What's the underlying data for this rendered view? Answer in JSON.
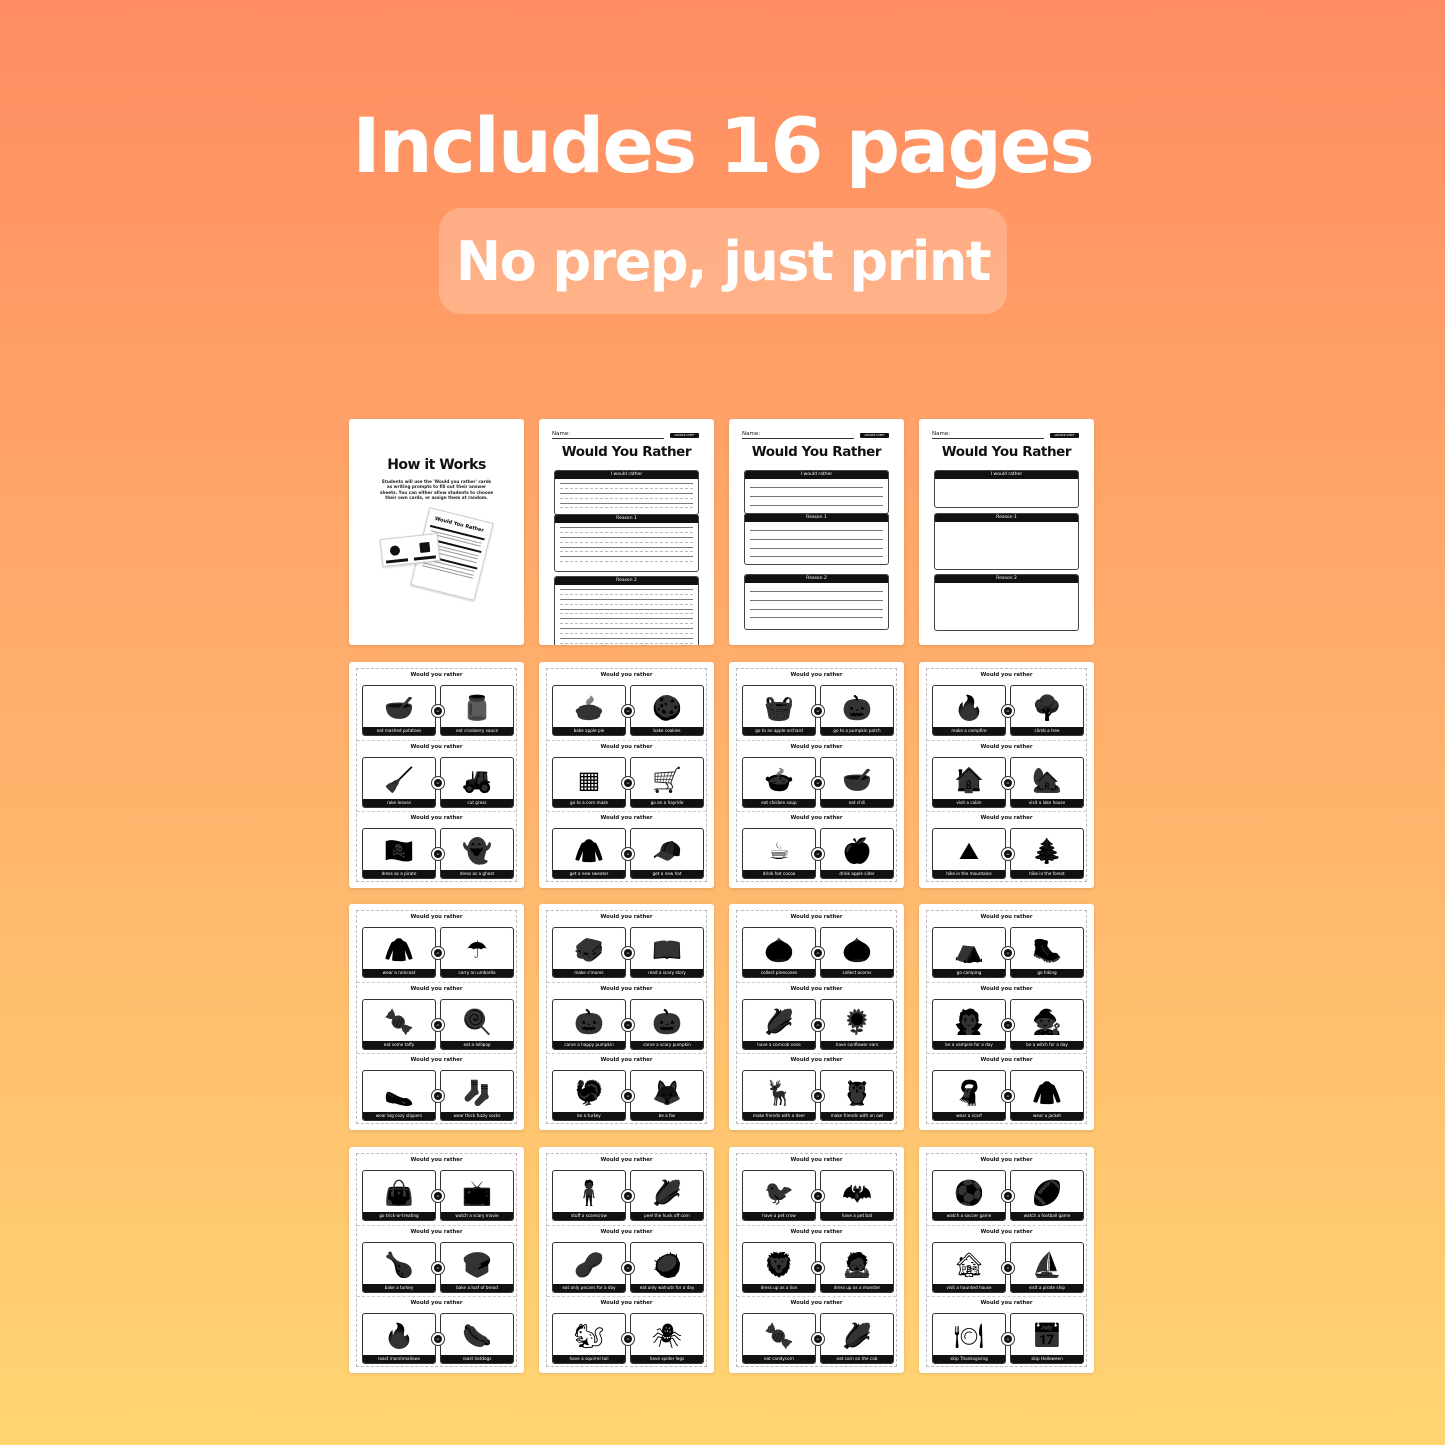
{
  "header": {
    "title": "Includes 16 pages",
    "subtitle": "No prep, just print"
  },
  "colors": {
    "gradient_top": "#ff8c62",
    "gradient_bottom": "#ffd572",
    "text": "#ffffff",
    "ink": "#111111"
  },
  "how_it_works": {
    "title": "How it Works",
    "body": "Students will use the 'Would you rather' cards as writing prompts to fill out their answer sheets. You can either allow students to choose their own cards, or assign them at random.",
    "illustration_title": "Would You Rather"
  },
  "answer_sheets": [
    {
      "name_label": "Name:",
      "badge": "ANSWER SHEET",
      "title": "Would You Rather",
      "sections": [
        "I would rather",
        "Reason 1",
        "Reason 2"
      ],
      "style": "dashed-lines"
    },
    {
      "name_label": "Name:",
      "badge": "ANSWER SHEET",
      "title": "Would You Rather",
      "sections": [
        "I would rather",
        "Reason 1",
        "Reason 2"
      ],
      "style": "lines"
    },
    {
      "name_label": "Name:",
      "badge": "ANSWER SHEET",
      "title": "Would You Rather",
      "sections": [
        "I would rather",
        "Reason 1",
        "Reason 2"
      ],
      "style": "blank"
    }
  ],
  "question_label": "Would you rather",
  "or_label": "or",
  "card_pages": [
    [
      [
        {
          "label": "eat mashed potatoes",
          "icon": "mashed-potatoes-icon",
          "glyph": "🥣"
        },
        {
          "label": "eat cranberry sauce",
          "icon": "jar-icon",
          "glyph": "🫙"
        }
      ],
      [
        {
          "label": "rake leaves",
          "icon": "rake-icon",
          "glyph": "🧹"
        },
        {
          "label": "cut grass",
          "icon": "lawnmower-icon",
          "glyph": "🚜"
        }
      ],
      [
        {
          "label": "dress as a pirate",
          "icon": "pirate-icon",
          "glyph": "🏴‍☠️"
        },
        {
          "label": "dress as a ghost",
          "icon": "ghost-icon",
          "glyph": "👻"
        }
      ]
    ],
    [
      [
        {
          "label": "bake apple pie",
          "icon": "pie-icon",
          "glyph": "🥧"
        },
        {
          "label": "bake cookies",
          "icon": "cookie-icon",
          "glyph": "🍪"
        }
      ],
      [
        {
          "label": "go to a corn maze",
          "icon": "maze-icon",
          "glyph": "▦"
        },
        {
          "label": "go on a hayride",
          "icon": "hay-cart-icon",
          "glyph": "🛒"
        }
      ],
      [
        {
          "label": "get a new sweater",
          "icon": "sweater-icon",
          "glyph": "🧥"
        },
        {
          "label": "get a new hat",
          "icon": "beanie-icon",
          "glyph": "🧢"
        }
      ]
    ],
    [
      [
        {
          "label": "go to an apple orchard",
          "icon": "apple-basket-icon",
          "glyph": "🧺"
        },
        {
          "label": "go to a pumpkin patch",
          "icon": "pumpkins-icon",
          "glyph": "🎃"
        }
      ],
      [
        {
          "label": "eat chicken soup",
          "icon": "soup-icon",
          "glyph": "🍲"
        },
        {
          "label": "eat chili",
          "icon": "chili-bowl-icon",
          "glyph": "🥣"
        }
      ],
      [
        {
          "label": "drink hot cocoa",
          "icon": "mug-icon",
          "glyph": "☕"
        },
        {
          "label": "drink apple cider",
          "icon": "cider-icon",
          "glyph": "🍎"
        }
      ]
    ],
    [
      [
        {
          "label": "make a campfire",
          "icon": "campfire-icon",
          "glyph": "🔥"
        },
        {
          "label": "climb a tree",
          "icon": "tree-icon",
          "glyph": "🌳"
        }
      ],
      [
        {
          "label": "visit a cabin",
          "icon": "cabin-icon",
          "glyph": "🏠"
        },
        {
          "label": "visit a lake house",
          "icon": "lake-house-icon",
          "glyph": "🏡"
        }
      ],
      [
        {
          "label": "hike in the mountains",
          "icon": "mountains-icon",
          "glyph": "⛰"
        },
        {
          "label": "hike in the forest",
          "icon": "forest-icon",
          "glyph": "🌲"
        }
      ]
    ],
    [
      [
        {
          "label": "wear a raincoat",
          "icon": "raincoat-icon",
          "glyph": "🧥"
        },
        {
          "label": "carry an umbrella",
          "icon": "umbrella-icon",
          "glyph": "☂"
        }
      ],
      [
        {
          "label": "eat some taffy",
          "icon": "candy-icon",
          "glyph": "🍬"
        },
        {
          "label": "eat a lollipop",
          "icon": "lollipop-icon",
          "glyph": "🍭"
        }
      ],
      [
        {
          "label": "wear big cozy slippers",
          "icon": "slippers-icon",
          "glyph": "🥿"
        },
        {
          "label": "wear thick fuzzy socks",
          "icon": "socks-icon",
          "glyph": "🧦"
        }
      ]
    ],
    [
      [
        {
          "label": "make s'mores",
          "icon": "smores-icon",
          "glyph": "🥪"
        },
        {
          "label": "read a scary story",
          "icon": "book-icon",
          "glyph": "📖"
        }
      ],
      [
        {
          "label": "carve a happy pumpkin",
          "icon": "happy-pumpkin-icon",
          "glyph": "🎃"
        },
        {
          "label": "carve a scary pumpkin",
          "icon": "scary-pumpkin-icon",
          "glyph": "🎃"
        }
      ],
      [
        {
          "label": "be a turkey",
          "icon": "turkey-icon",
          "glyph": "🦃"
        },
        {
          "label": "be a fox",
          "icon": "fox-icon",
          "glyph": "🦊"
        }
      ]
    ],
    [
      [
        {
          "label": "collect pinecones",
          "icon": "pinecone-icon",
          "glyph": "🌰"
        },
        {
          "label": "collect acorns",
          "icon": "acorn-icon",
          "glyph": "🌰"
        }
      ],
      [
        {
          "label": "have a corncob nose",
          "icon": "corn-icon",
          "glyph": "🌽"
        },
        {
          "label": "have sunflower ears",
          "icon": "sunflower-icon",
          "glyph": "🌻"
        }
      ],
      [
        {
          "label": "make friends with a deer",
          "icon": "deer-icon",
          "glyph": "🦌"
        },
        {
          "label": "make friends with an owl",
          "icon": "owl-icon",
          "glyph": "🦉"
        }
      ]
    ],
    [
      [
        {
          "label": "go camping",
          "icon": "tent-icon",
          "glyph": "⛺"
        },
        {
          "label": "go hiking",
          "icon": "hiker-icon",
          "glyph": "🥾"
        }
      ],
      [
        {
          "label": "be a vampire for a day",
          "icon": "vampire-icon",
          "glyph": "🧛"
        },
        {
          "label": "be a witch for a day",
          "icon": "witch-icon",
          "glyph": "🧙"
        }
      ],
      [
        {
          "label": "wear a scarf",
          "icon": "scarf-icon",
          "glyph": "🧣"
        },
        {
          "label": "wear a jacket",
          "icon": "jacket-icon",
          "glyph": "🧥"
        }
      ]
    ],
    [
      [
        {
          "label": "go trick-or-treating",
          "icon": "candy-bag-icon",
          "glyph": "👜"
        },
        {
          "label": "watch a scary movie",
          "icon": "tv-icon",
          "glyph": "📺"
        }
      ],
      [
        {
          "label": "bake a turkey",
          "icon": "roast-turkey-icon",
          "glyph": "🍗"
        },
        {
          "label": "bake a loaf of bread",
          "icon": "bread-icon",
          "glyph": "🍞"
        }
      ],
      [
        {
          "label": "roast marshmallows",
          "icon": "marshmallow-icon",
          "glyph": "🔥"
        },
        {
          "label": "roast hotdogs",
          "icon": "hotdog-icon",
          "glyph": "🌭"
        }
      ]
    ],
    [
      [
        {
          "label": "stuff a scarecrow",
          "icon": "scarecrow-icon",
          "glyph": "🧍"
        },
        {
          "label": "peel the husk off corn",
          "icon": "corn-husk-icon",
          "glyph": "🌽"
        }
      ],
      [
        {
          "label": "eat only pecans for a day",
          "icon": "pecans-icon",
          "glyph": "🥜"
        },
        {
          "label": "eat only walnuts for a day",
          "icon": "walnut-icon",
          "glyph": "🥥"
        }
      ],
      [
        {
          "label": "have a squirrel tail",
          "icon": "squirrel-icon",
          "glyph": "🐿"
        },
        {
          "label": "have spider legs",
          "icon": "spider-icon",
          "glyph": "🕷"
        }
      ]
    ],
    [
      [
        {
          "label": "have a pet crow",
          "icon": "crow-icon",
          "glyph": "🐦"
        },
        {
          "label": "have a pet bat",
          "icon": "bat-icon",
          "glyph": "🦇"
        }
      ],
      [
        {
          "label": "dress up as a lion",
          "icon": "lion-icon",
          "glyph": "🦁"
        },
        {
          "label": "dress up as a monster",
          "icon": "monster-icon",
          "glyph": "🧟"
        }
      ],
      [
        {
          "label": "eat candycorn",
          "icon": "candycorn-icon",
          "glyph": "🍬"
        },
        {
          "label": "eat corn on the cob",
          "icon": "corn-crate-icon",
          "glyph": "🌽"
        }
      ]
    ],
    [
      [
        {
          "label": "watch a soccer game",
          "icon": "soccer-ball-icon",
          "glyph": "⚽"
        },
        {
          "label": "watch a football game",
          "icon": "football-icon",
          "glyph": "🏈"
        }
      ],
      [
        {
          "label": "visit a haunted house",
          "icon": "haunted-house-icon",
          "glyph": "🏚"
        },
        {
          "label": "visit a pirate ship",
          "icon": "pirate-ship-icon",
          "glyph": "⛵"
        }
      ],
      [
        {
          "label": "skip Thanksgiving",
          "icon": "dinner-plate-icon",
          "glyph": "🍽"
        },
        {
          "label": "skip Halloween",
          "icon": "calendar-pumpkin-icon",
          "glyph": "📅"
        }
      ]
    ]
  ]
}
